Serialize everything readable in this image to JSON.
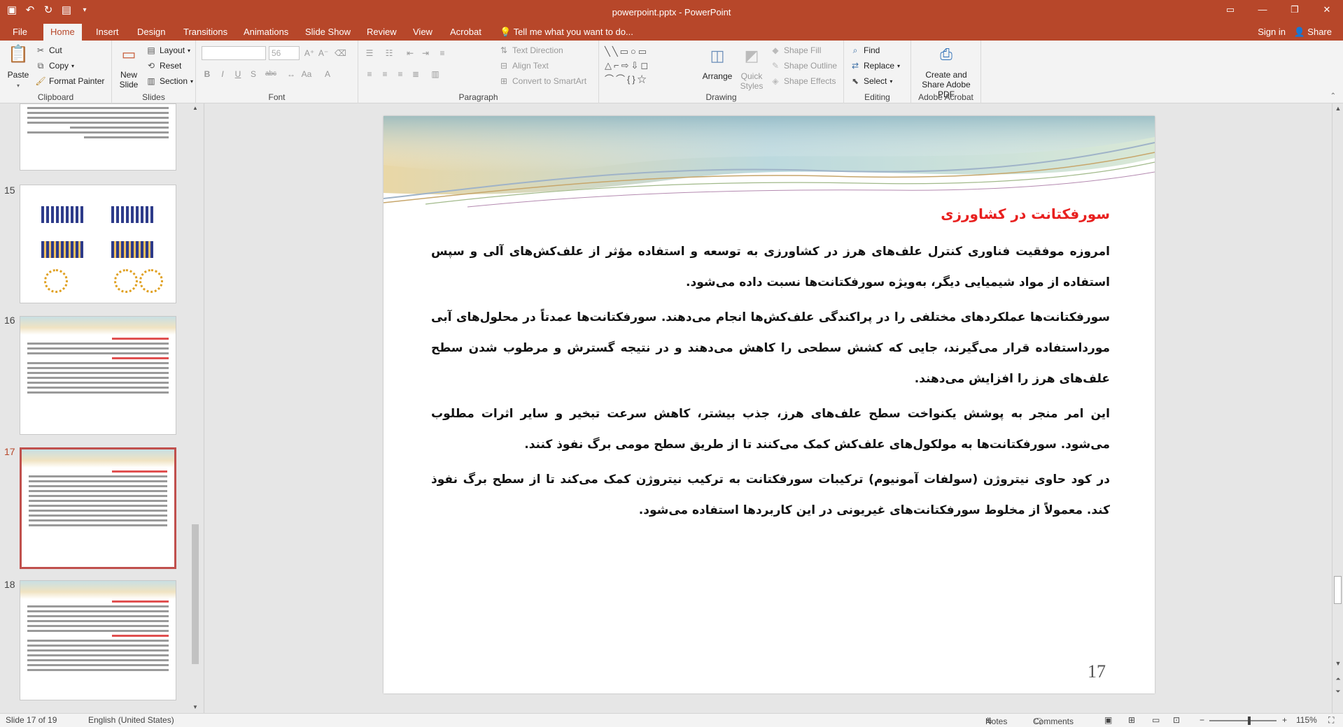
{
  "window": {
    "title": "powerpoint.pptx - PowerPoint",
    "buttons": [
      "▭",
      "—",
      "❐",
      "✕"
    ]
  },
  "quick_access": [
    "save-icon",
    "undo-icon",
    "redo-icon",
    "start-from-beginning-icon",
    "customize-icon"
  ],
  "tabs": [
    {
      "label": "File"
    },
    {
      "label": "Home",
      "active": true
    },
    {
      "label": "Insert"
    },
    {
      "label": "Design"
    },
    {
      "label": "Transitions"
    },
    {
      "label": "Animations"
    },
    {
      "label": "Slide Show"
    },
    {
      "label": "Review"
    },
    {
      "label": "View"
    },
    {
      "label": "Acrobat"
    }
  ],
  "tell_me": "Tell me what you want to do...",
  "sign_in": "Sign in",
  "share": "Share",
  "ribbon": {
    "clipboard": {
      "label": "Clipboard",
      "paste": "Paste",
      "cut": "Cut",
      "copy": "Copy",
      "format_painter": "Format Painter"
    },
    "slides": {
      "label": "Slides",
      "new_slide": "New Slide",
      "layout": "Layout",
      "reset": "Reset",
      "section": "Section"
    },
    "font": {
      "label": "Font",
      "font_name": "",
      "font_size": "56",
      "bold": "B",
      "italic": "I",
      "underline": "U",
      "shadow": "S",
      "strike": "abc"
    },
    "paragraph": {
      "label": "Paragraph",
      "text_direction": "Text Direction",
      "align_text": "Align Text",
      "convert_smartart": "Convert to SmartArt"
    },
    "drawing": {
      "label": "Drawing",
      "arrange": "Arrange",
      "quick_styles": "Quick Styles",
      "shape_fill": "Shape Fill",
      "shape_outline": "Shape Outline",
      "shape_effects": "Shape Effects"
    },
    "editing": {
      "label": "Editing",
      "find": "Find",
      "replace": "Replace",
      "select": "Select"
    },
    "acrobat": {
      "label": "Adobe Acrobat",
      "create_share": "Create and Share Adobe PDF"
    }
  },
  "thumbnails": [
    {
      "number": "15",
      "active": false
    },
    {
      "number": "16",
      "active": false
    },
    {
      "number": "17",
      "active": true
    },
    {
      "number": "18",
      "active": false
    }
  ],
  "slide": {
    "title": "سورفکتانت در کشاورزی",
    "paragraphs": [
      "امروزه موفقیت فناوری کنترل علف‌های هرز در کشاورزی به توسعه و استفاده مؤثر از علف‌کش‌های آلی و سپس استفاده از مواد شیمیایی دیگر، به‌ویژه سورفکتانت‌ها نسبت داده می‌شود.",
      "سورفکتانت‌ها عملکردهای مختلفی را در پراکندگی علف‌کش‌ها انجام می‌دهند. سورفکتانت‌ها عمدتاً در محلول‌های آبی مورداستفاده قرار می‌گیرند، جایی که کشش سطحی را کاهش می‌دهند و در نتیجه گسترش و مرطوب شدن سطح علف‌های هرز را افزایش می‌دهند.",
      "این امر منجر به پوشش یکنواخت سطح علف‌های هرز، جذب بیشتر، کاهش سرعت تبخیر و سایر اثرات مطلوب می‌شود. سورفکتانت‌ها به مولکول‌های علف‌کش کمک می‌کنند تا از طریق سطح مومی برگ نفوذ کنند.",
      "در کود حاوی نیتروژن (سولفات آمونیوم) ترکیبات سورفکتانت به ترکیب نیتروژن کمک می‌کند تا از سطح برگ نفوذ کند. معمولاً از مخلوط سورفکتانت‌های غیریونی در این کاربردها استفاده می‌شود."
    ],
    "number": "17"
  },
  "status": {
    "slide_info": "Slide 17 of 19",
    "language": "English (United States)",
    "notes": "Notes",
    "comments": "Comments",
    "zoom": "115%"
  }
}
